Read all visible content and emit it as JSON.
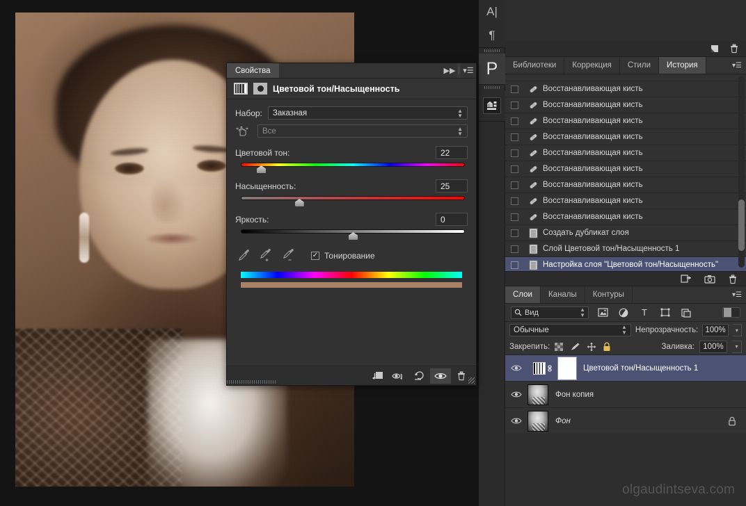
{
  "app": {
    "watermark": "olgaudintseva.com"
  },
  "toolbar_vertical": {
    "items": [
      {
        "name": "character-panel",
        "glyph": "A|"
      },
      {
        "name": "paragraph-panel",
        "glyph": "¶"
      },
      {
        "name": "properties-panel",
        "glyph": "P"
      },
      {
        "name": "libraries-panel",
        "glyph": "▣"
      }
    ]
  },
  "properties": {
    "tab_label": "Свойства",
    "collapse_label": "▶▶",
    "menu_label": "▾☰",
    "title": "Цветовой тон/Насыщенность",
    "preset_label": "Набор:",
    "preset_value": "Заказная",
    "range_value": "Все",
    "hue": {
      "label": "Цветовой тон:",
      "value": "22",
      "thumb_pct": 9
    },
    "saturation": {
      "label": "Насыщенность:",
      "value": "25",
      "thumb_pct": 26
    },
    "lightness": {
      "label": "Яркость:",
      "value": "0",
      "thumb_pct": 50
    },
    "colorize_label": "Тонирование",
    "colorize_checked": "✓",
    "result_color": "#a9826a",
    "footer_buttons": [
      {
        "name": "clip-to-layer-button",
        "glyph": "⇱▣"
      },
      {
        "name": "view-previous-state-button",
        "glyph": "◉⟩"
      },
      {
        "name": "reset-button",
        "glyph": "↺"
      },
      {
        "name": "toggle-visibility-button",
        "glyph": "◉"
      },
      {
        "name": "delete-adjustment-button",
        "glyph": "🗑"
      }
    ]
  },
  "history_panel": {
    "tabs": [
      {
        "label": "Библиотеки",
        "active": false
      },
      {
        "label": "Коррекция",
        "active": false
      },
      {
        "label": "Стили",
        "active": false
      },
      {
        "label": "История",
        "active": true
      }
    ],
    "menu_label": "▾☰",
    "top_buttons": [
      {
        "name": "new-document-button",
        "glyph": "▤"
      },
      {
        "name": "delete-button",
        "glyph": "🗑"
      }
    ],
    "items": [
      {
        "label": "Восстанавливающая кисть",
        "icon": "healing-brush-icon",
        "selected": false
      },
      {
        "label": "Восстанавливающая кисть",
        "icon": "healing-brush-icon",
        "selected": false
      },
      {
        "label": "Восстанавливающая кисть",
        "icon": "healing-brush-icon",
        "selected": false
      },
      {
        "label": "Восстанавливающая кисть",
        "icon": "healing-brush-icon",
        "selected": false
      },
      {
        "label": "Восстанавливающая кисть",
        "icon": "healing-brush-icon",
        "selected": false
      },
      {
        "label": "Восстанавливающая кисть",
        "icon": "healing-brush-icon",
        "selected": false
      },
      {
        "label": "Восстанавливающая кисть",
        "icon": "healing-brush-icon",
        "selected": false
      },
      {
        "label": "Восстанавливающая кисть",
        "icon": "healing-brush-icon",
        "selected": false
      },
      {
        "label": "Восстанавливающая кисть",
        "icon": "healing-brush-icon",
        "selected": false
      },
      {
        "label": "Создать дубликат слоя",
        "icon": "document-icon",
        "selected": false
      },
      {
        "label": "Слой Цветовой тон/Насыщенность 1",
        "icon": "document-icon",
        "selected": false
      },
      {
        "label": "Настройка слоя \"Цветовой тон/Насыщенность\"",
        "icon": "document-icon",
        "selected": true
      }
    ],
    "bottom_buttons": [
      {
        "name": "new-document-from-state-button",
        "glyph": "⊞"
      },
      {
        "name": "new-snapshot-button",
        "glyph": "▣"
      },
      {
        "name": "delete-state-button",
        "glyph": "🗑"
      }
    ]
  },
  "layers_panel": {
    "tabs": [
      {
        "label": "Слои",
        "active": true
      },
      {
        "label": "Каналы",
        "active": false
      },
      {
        "label": "Контуры",
        "active": false
      }
    ],
    "menu_label": "▾☰",
    "filter_value": "Вид",
    "filter_icons": [
      {
        "name": "filter-pixel-icon",
        "glyph": "▣"
      },
      {
        "name": "filter-adjustment-icon",
        "glyph": "◑"
      },
      {
        "name": "filter-type-icon",
        "glyph": "T"
      },
      {
        "name": "filter-shape-icon",
        "glyph": "⬚"
      },
      {
        "name": "filter-smart-object-icon",
        "glyph": "⎕"
      }
    ],
    "blend_mode": "Обычные",
    "opacity_label": "Непрозрачность:",
    "opacity_value": "100%",
    "lock_label": "Закрепить:",
    "lock_icons": [
      {
        "name": "lock-transparency-icon",
        "glyph": "▩"
      },
      {
        "name": "lock-image-icon",
        "glyph": "✎"
      },
      {
        "name": "lock-position-icon",
        "glyph": "✥"
      },
      {
        "name": "lock-all-icon",
        "glyph": "🔒"
      }
    ],
    "fill_label": "Заливка:",
    "fill_value": "100%",
    "layers": [
      {
        "name": "Цветовой тон/Насыщенность 1",
        "type": "adjustment",
        "selected": true,
        "locked": false,
        "italic": false
      },
      {
        "name": "Фон копия",
        "type": "pixel",
        "selected": false,
        "locked": false,
        "italic": false
      },
      {
        "name": "Фон",
        "type": "pixel",
        "selected": false,
        "locked": true,
        "italic": true
      }
    ]
  }
}
